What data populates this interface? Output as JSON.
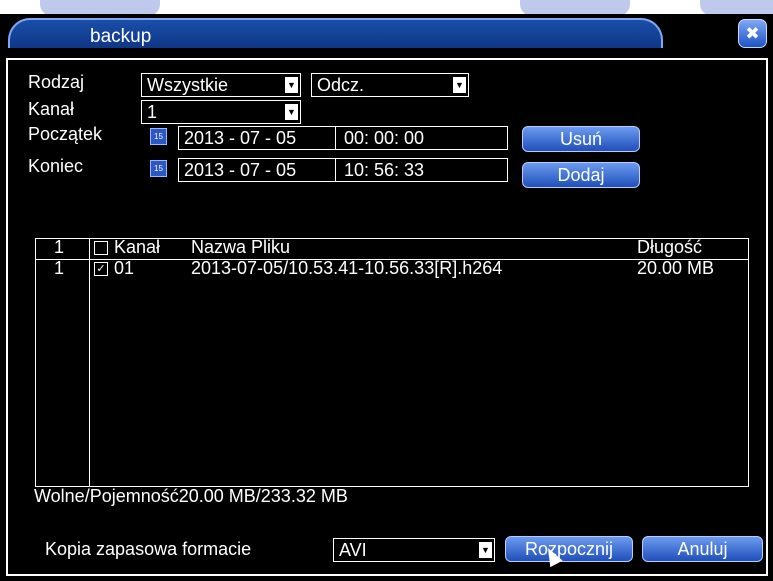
{
  "window": {
    "title": "backup",
    "close_glyph": "✖"
  },
  "filters": {
    "type_label": "Rodzaj",
    "type_value": "Wszystkie",
    "mode_value": "Odcz.",
    "channel_label": "Kanał",
    "channel_value": "1",
    "start_label": "Początek",
    "start_date": "2013 - 07 - 05",
    "start_time": "00: 00: 00",
    "end_label": "Koniec",
    "end_date": "2013 - 07 - 05",
    "end_time": "10: 56: 33",
    "remove_button": "Usuń",
    "add_button": "Dodaj"
  },
  "table": {
    "headers": {
      "index": "1",
      "channel": "Kanał",
      "filename": "Nazwa Pliku",
      "length": "Długość"
    },
    "rows": [
      {
        "index": "1",
        "checked": true,
        "channel": "01",
        "filename": "2013-07-05/10.53.41-10.56.33[R].h264",
        "length": "20.00 MB"
      }
    ]
  },
  "capacity": "Wolne/Pojemność20.00 MB/233.32 MB",
  "footer": {
    "format_label": "Kopia zapasowa formacie",
    "format_value": "AVI",
    "start_button": "Rozpocznij",
    "cancel_button": "Anuluj"
  },
  "icons": {
    "dropdown": "chevron-down-icon",
    "calendar": "calendar-icon",
    "close": "close-icon",
    "cursor": "mouse-cursor-icon"
  },
  "colors": {
    "background": "#000000",
    "text": "#ffffff",
    "accent": "#1a4ea9",
    "button": "#3a6fd8"
  }
}
